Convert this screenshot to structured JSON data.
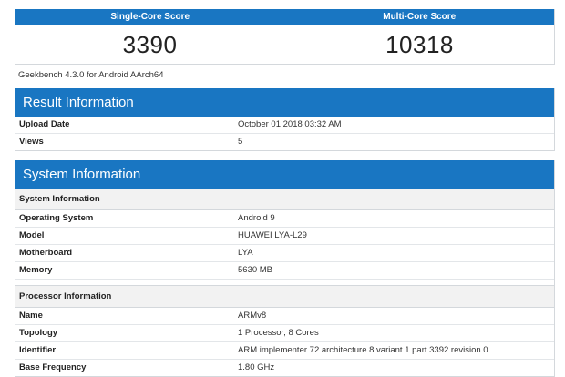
{
  "scores": {
    "single_label": "Single-Core Score",
    "multi_label": "Multi-Core Score",
    "single_value": "3390",
    "multi_value": "10318"
  },
  "version_text": "Geekbench 4.3.0 for Android AArch64",
  "result": {
    "title": "Result Information",
    "rows": [
      {
        "key": "Upload Date",
        "value": "October 01 2018 03:32 AM"
      },
      {
        "key": "Views",
        "value": "5"
      }
    ]
  },
  "system": {
    "title": "System Information",
    "sys_subhead": "System Information",
    "sys_rows": [
      {
        "key": "Operating System",
        "value": "Android 9"
      },
      {
        "key": "Model",
        "value": "HUAWEI LYA-L29"
      },
      {
        "key": "Motherboard",
        "value": "LYA"
      },
      {
        "key": "Memory",
        "value": "5630 MB"
      }
    ],
    "proc_subhead": "Processor Information",
    "proc_rows": [
      {
        "key": "Name",
        "value": "ARMv8"
      },
      {
        "key": "Topology",
        "value": "1 Processor, 8 Cores"
      },
      {
        "key": "Identifier",
        "value": "ARM implementer 72 architecture 8 variant 1 part 3392 revision 0"
      },
      {
        "key": "Base Frequency",
        "value": "1.80 GHz"
      }
    ]
  },
  "colors": {
    "accent": "#1976c2",
    "subheader_bg": "#f2f2f2",
    "border": "#d4d8dc"
  }
}
